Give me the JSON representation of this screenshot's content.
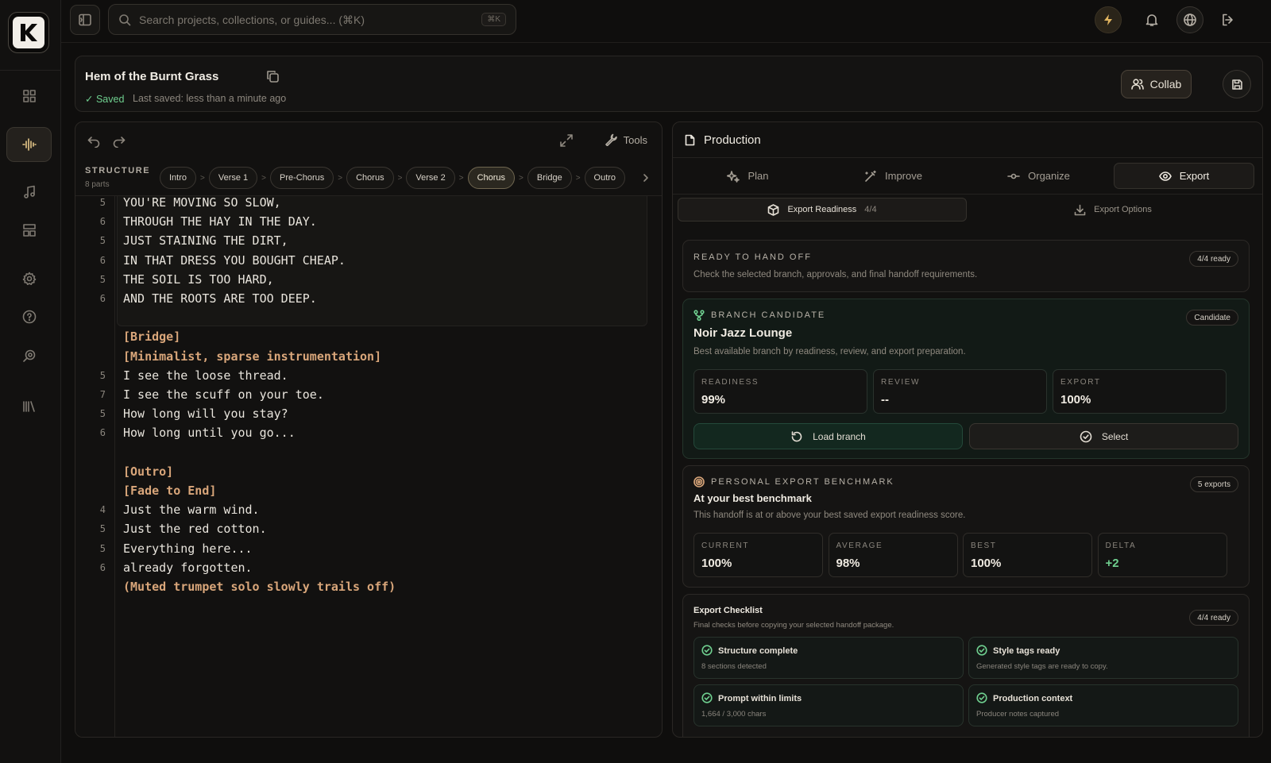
{
  "topbar": {
    "search_placeholder": "Search projects, collections, or guides... (⌘K)",
    "search_shortcut": "⌘K"
  },
  "document": {
    "title": "Hem of the Burnt Grass",
    "saved_label": "✓ Saved",
    "last_saved": "Last saved: less than a minute ago",
    "collab_label": "Collab"
  },
  "editor": {
    "tools_label": "Tools",
    "structure_label": "STRUCTURE",
    "parts_count": "8 parts",
    "chips": [
      "Intro",
      "Verse 1",
      "Pre-Chorus",
      "Chorus",
      "Verse 2",
      "Chorus",
      "Bridge",
      "Outro"
    ],
    "active_chip_index": 5,
    "lines": [
      {
        "n": "5",
        "text": "YOU'RE MOVING SO SLOW,",
        "tag": false
      },
      {
        "n": "6",
        "text": "THROUGH THE HAY IN THE DAY.",
        "tag": false
      },
      {
        "n": "5",
        "text": "JUST STAINING THE DIRT,",
        "tag": false
      },
      {
        "n": "6",
        "text": "IN THAT DRESS YOU BOUGHT CHEAP.",
        "tag": false
      },
      {
        "n": "5",
        "text": "THE SOIL IS TOO HARD,",
        "tag": false
      },
      {
        "n": "6",
        "text": "AND THE ROOTS ARE TOO DEEP.",
        "tag": false
      },
      {
        "n": "",
        "text": "",
        "tag": false
      },
      {
        "n": "",
        "text": "[Bridge]",
        "tag": true
      },
      {
        "n": "",
        "text": "[Minimalist, sparse instrumentation]",
        "tag": true
      },
      {
        "n": "5",
        "text": "I see the loose thread.",
        "tag": false
      },
      {
        "n": "7",
        "text": "I see the scuff on your toe.",
        "tag": false
      },
      {
        "n": "5",
        "text": "How long will you stay?",
        "tag": false
      },
      {
        "n": "6",
        "text": "How long until you go...",
        "tag": false
      },
      {
        "n": "",
        "text": "",
        "tag": false
      },
      {
        "n": "",
        "text": "[Outro]",
        "tag": true
      },
      {
        "n": "",
        "text": "[Fade to End]",
        "tag": true
      },
      {
        "n": "4",
        "text": "Just the warm wind.",
        "tag": false
      },
      {
        "n": "5",
        "text": "Just the red cotton.",
        "tag": false
      },
      {
        "n": "5",
        "text": "Everything here...",
        "tag": false
      },
      {
        "n": "6",
        "text": "already forgotten.",
        "tag": false
      },
      {
        "n": "",
        "text": "(Muted trumpet solo slowly trails off)",
        "tag": true
      }
    ]
  },
  "production": {
    "title": "Production",
    "tabs": {
      "plan": "Plan",
      "improve": "Improve",
      "organize": "Organize",
      "export": "Export"
    },
    "subtabs": {
      "readiness": "Export Readiness",
      "readiness_count": "4/4",
      "options": "Export Options"
    },
    "handoff": {
      "eyebrow": "READY TO HAND OFF",
      "pill": "4/4 ready",
      "desc": "Check the selected branch, approvals, and final handoff requirements."
    },
    "branch": {
      "eyebrow": "BRANCH CANDIDATE",
      "pill": "Candidate",
      "name": "Noir Jazz Lounge",
      "desc": "Best available branch by readiness, review, and export preparation.",
      "metrics": [
        {
          "label": "READINESS",
          "value": "99%"
        },
        {
          "label": "REVIEW",
          "value": "--"
        },
        {
          "label": "EXPORT",
          "value": "100%"
        }
      ],
      "load_label": "Load branch",
      "select_label": "Select"
    },
    "benchmark": {
      "eyebrow": "PERSONAL EXPORT BENCHMARK",
      "pill": "5 exports",
      "title": "At your best benchmark",
      "desc": "This handoff is at or above your best saved export readiness score.",
      "metrics": [
        {
          "label": "CURRENT",
          "value": "100%"
        },
        {
          "label": "AVERAGE",
          "value": "98%"
        },
        {
          "label": "BEST",
          "value": "100%"
        },
        {
          "label": "DELTA",
          "value": "+2"
        }
      ]
    },
    "checklist": {
      "title": "Export Checklist",
      "desc": "Final checks before copying your selected handoff package.",
      "pill": "4/4 ready",
      "items": [
        {
          "title": "Structure complete",
          "desc": "8 sections detected"
        },
        {
          "title": "Style tags ready",
          "desc": "Generated style tags are ready to copy."
        },
        {
          "title": "Prompt within limits",
          "desc": "1,664 / 3,000 chars"
        },
        {
          "title": "Production context",
          "desc": "Producer notes captured"
        }
      ]
    }
  },
  "colors": {
    "accent_green": "#6fcf8f",
    "tag_color": "#d9a67a",
    "active_nav": "#e8c98a"
  }
}
